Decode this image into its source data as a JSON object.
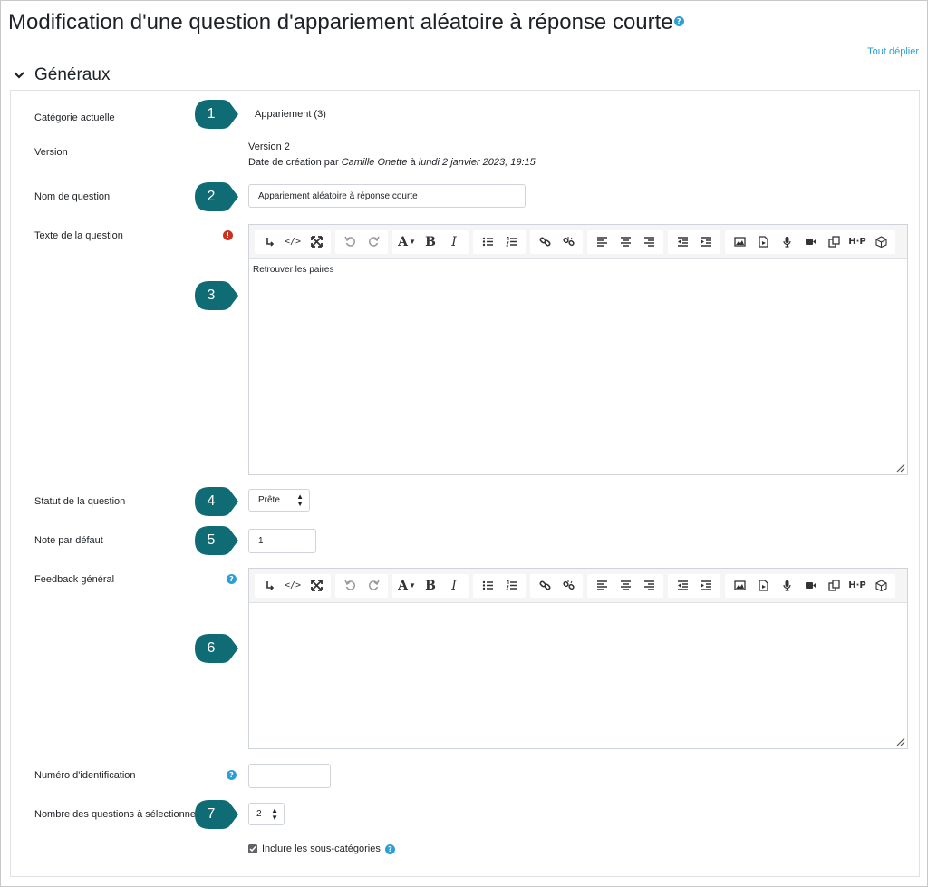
{
  "page": {
    "title": "Modification d'une question d'appariement aléatoire à réponse courte",
    "expand_all": "Tout déplier"
  },
  "section": {
    "title": "Généraux"
  },
  "form": {
    "category": {
      "label": "Catégorie actuelle",
      "value": "Appariement (3)"
    },
    "version": {
      "label": "Version",
      "link": "Version 2",
      "meta_prefix": "Date de création par",
      "author": "Camille Onette",
      "meta_mid": "à",
      "date": "lundi 2 janvier 2023, 19:15"
    },
    "question_name": {
      "label": "Nom de question",
      "value": "Appariement aléatoire à réponse courte"
    },
    "question_text": {
      "label": "Texte de la question",
      "content": "Retrouver les paires",
      "required_icon": "!"
    },
    "status": {
      "label": "Statut de la question",
      "selected": "Prête"
    },
    "default_mark": {
      "label": "Note par défaut",
      "value": "1"
    },
    "general_feedback": {
      "label": "Feedback général",
      "content": ""
    },
    "idnumber": {
      "label": "Numéro d'identification",
      "value": ""
    },
    "choose": {
      "label": "Nombre des questions à sélectionner",
      "selected": "2"
    },
    "include_subcats": {
      "label": "Inclure les sous-catégories",
      "checked": true
    }
  },
  "toolbar_icons": [
    "show-more-icon",
    "html-icon",
    "fullscreen-icon",
    "undo-icon",
    "redo-icon",
    "font-color-icon",
    "bold-icon",
    "italic-icon",
    "unordered-list-icon",
    "ordered-list-icon",
    "link-icon",
    "unlink-icon",
    "align-left-icon",
    "align-center-icon",
    "align-right-icon",
    "outdent-icon",
    "indent-icon",
    "image-icon",
    "media-icon",
    "record-audio-icon",
    "record-video-icon",
    "manage-files-icon",
    "h5p-icon",
    "accessibility-icon"
  ],
  "markers": [
    "1",
    "2",
    "3",
    "4",
    "5",
    "6",
    "7"
  ],
  "colors": {
    "marker": "#0f6b74",
    "link": "#2b9fd6",
    "error": "#ca3120"
  }
}
